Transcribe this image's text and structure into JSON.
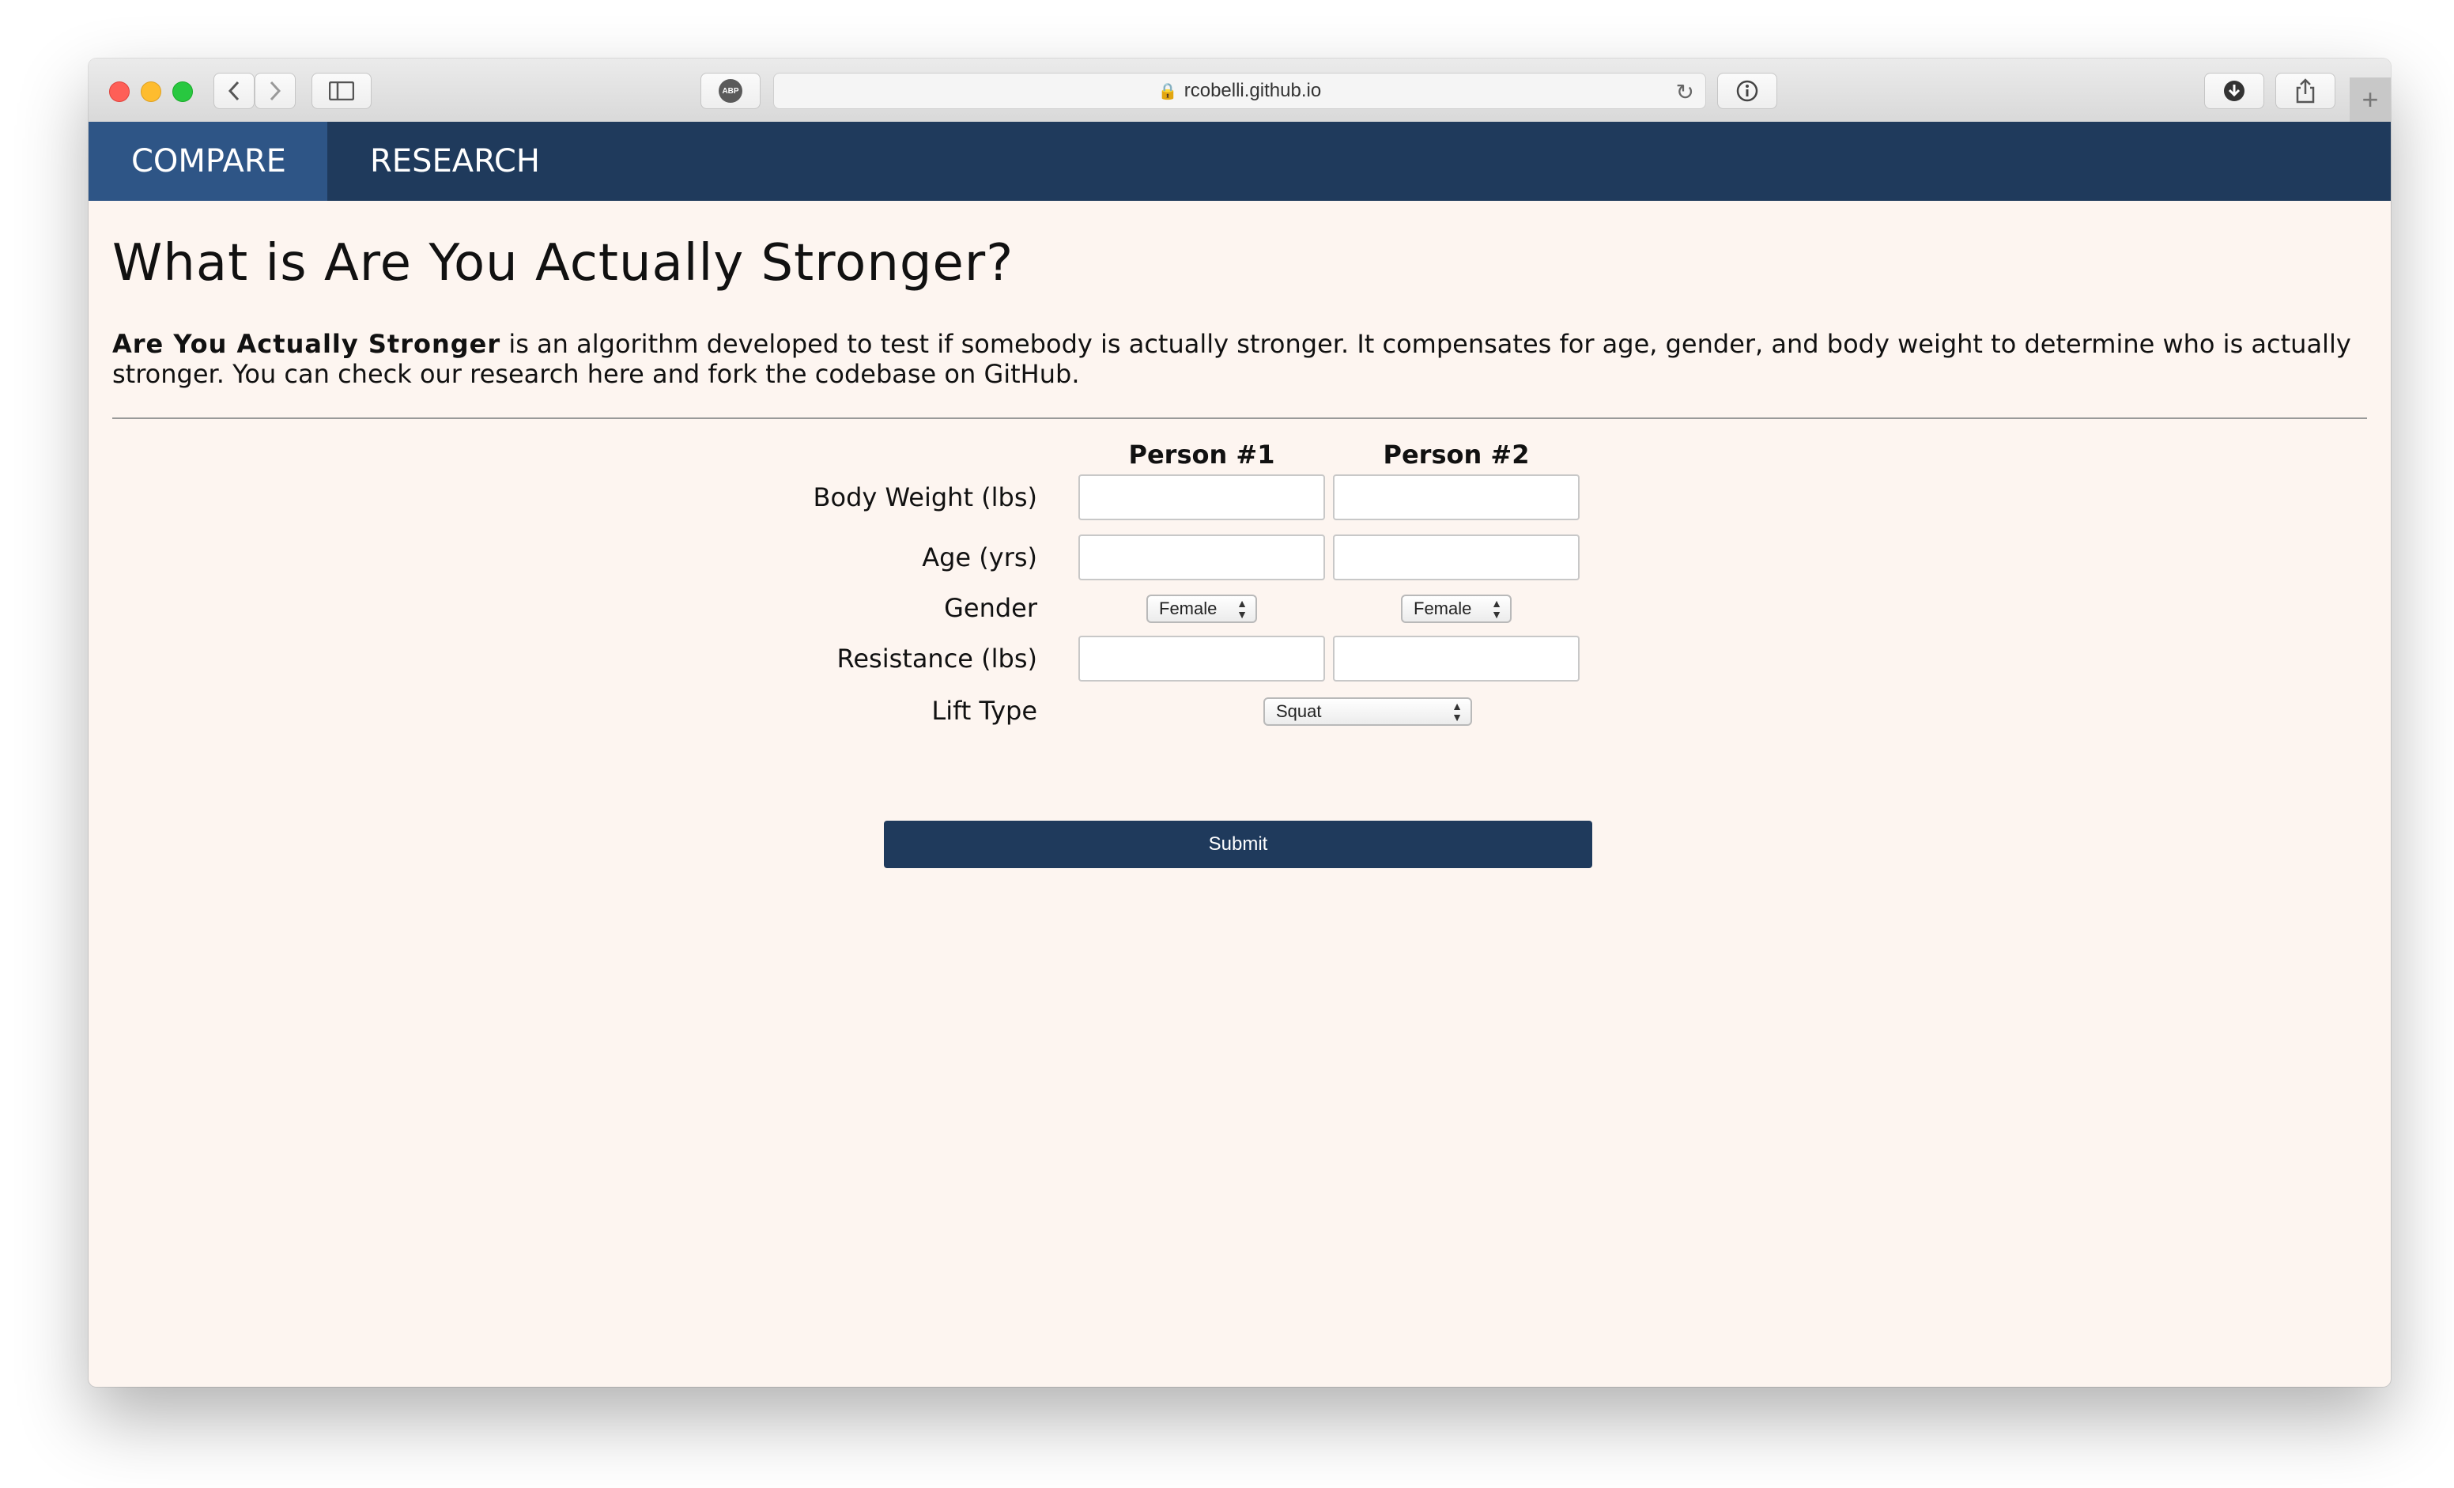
{
  "browser": {
    "url": "rcobelli.github.io",
    "abp_label": "ABP",
    "new_tab": "+"
  },
  "nav": {
    "items": [
      {
        "label": "COMPARE",
        "active": true
      },
      {
        "label": "RESEARCH",
        "active": false
      }
    ]
  },
  "page": {
    "title": "What is Are You Actually Stronger?",
    "intro_bold": "Are You Actually Stronger",
    "intro_rest": " is an algorithm developed to test if somebody is actually stronger. It compensates for age, gender, and body weight to determine who is actually stronger. You can check our research here and fork the codebase on GitHub."
  },
  "form": {
    "columns": [
      "Person #1",
      "Person #2"
    ],
    "labels": {
      "body_weight": "Body Weight (lbs)",
      "age": "Age (yrs)",
      "gender": "Gender",
      "resistance": "Resistance (lbs)",
      "lift_type": "Lift Type"
    },
    "values": {
      "p1_body_weight": "",
      "p2_body_weight": "",
      "p1_age": "",
      "p2_age": "",
      "p1_gender": "Female",
      "p2_gender": "Female",
      "p1_resistance": "",
      "p2_resistance": "",
      "lift_type": "Squat"
    },
    "submit_label": "Submit"
  },
  "colors": {
    "navbar": "#1f3a5c",
    "nav_active": "#2e5586",
    "page_bg": "#fdf5f0",
    "submit_bg": "#1f3a5c"
  }
}
